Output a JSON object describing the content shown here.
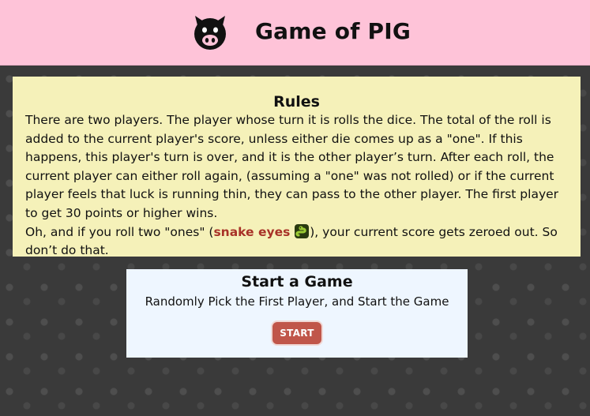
{
  "header": {
    "title": "Game of PIG",
    "logo_icon": "pig-icon"
  },
  "rules": {
    "heading": "Rules",
    "paragraph1": "There are two players. The player whose turn it is rolls the dice. The total of the roll is added to the current player's score, unless either die comes up as a \"one\". If this happens, this player's turn is over, and it is the other player’s turn. After each roll, the current player can either roll again, (assuming a \"one\" was not rolled) or if the current player feels that luck is running thin, they can pass to the other player. The first player to get 30 points or higher wins.",
    "paragraph2_before": "Oh, and if you roll two \"ones\" (",
    "snake_eyes": "snake eyes",
    "snake_icon": "snake-icon",
    "paragraph2_after": "), your current score gets zeroed out. So don’t do that.",
    "highlight_color": "#a83228"
  },
  "start_game": {
    "heading": "Start a Game",
    "subtitle": "Randomly Pick the First Player, and Start the Game",
    "button_label": "START",
    "button_color": "#c0564a"
  },
  "colors": {
    "header_bg": "#fec3d8",
    "rules_bg": "#f5f1b9",
    "start_panel_bg": "#eef6ff",
    "page_bg": "#3a3a3a"
  }
}
